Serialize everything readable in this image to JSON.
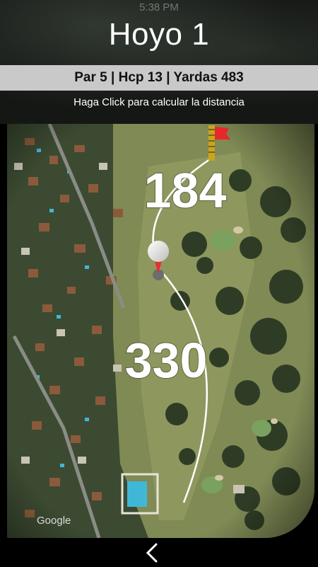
{
  "status": {
    "time": "5:38 PM"
  },
  "hole": {
    "title": "Hoyo 1",
    "info": "Par 5 | Hcp 13 | Yardas 483",
    "hint": "Haga Click para calcular la distancia"
  },
  "map": {
    "distance_to_flag": "184",
    "distance_from_tee": "330",
    "attribution": "Google",
    "icons": [
      "flag-icon",
      "golf-ball-marker-icon",
      "back-chevron-icon"
    ]
  },
  "colors": {
    "flag": "#e8262b",
    "info_bar": "#c9c9c9",
    "arc": "#ffffff",
    "marker": "#e53030"
  }
}
